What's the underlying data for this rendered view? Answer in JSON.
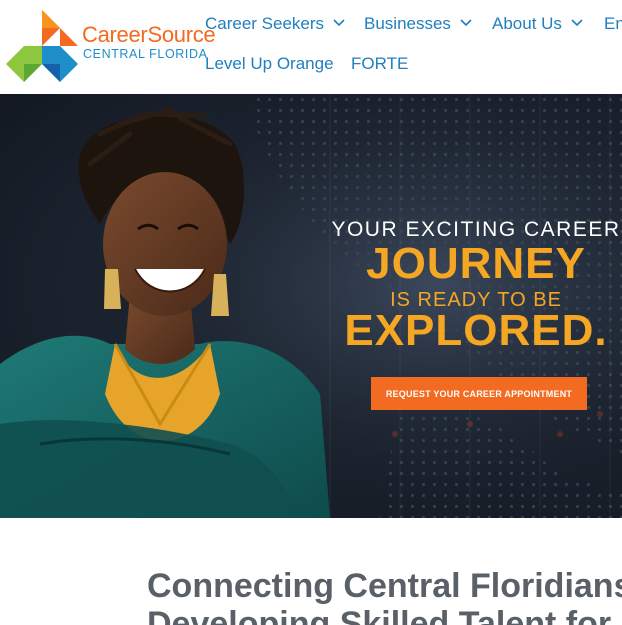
{
  "logo": {
    "line1": "CareerSource",
    "line2": "CENTRAL FLORIDA"
  },
  "nav": {
    "career_seekers": "Career Seekers",
    "businesses": "Businesses",
    "about_us": "About Us",
    "en": "En",
    "level_up": "Level Up Orange",
    "forte": "FORTE"
  },
  "hero": {
    "line1": "YOUR EXCITING CAREER",
    "line2": "JOURNEY",
    "line3": "IS READY   TO BE",
    "line4": "EXPLORED.",
    "cta": "REQUEST YOUR CAREER APPOINTMENT"
  },
  "section": {
    "heading_line1": "Connecting Central Floridians",
    "heading_line2": "Developing Skilled Talent for"
  },
  "colors": {
    "brand_orange": "#f26b21",
    "brand_blue": "#1d8ec9",
    "accent_yellow": "#f5a623",
    "nav_link": "#1f7fbf"
  }
}
